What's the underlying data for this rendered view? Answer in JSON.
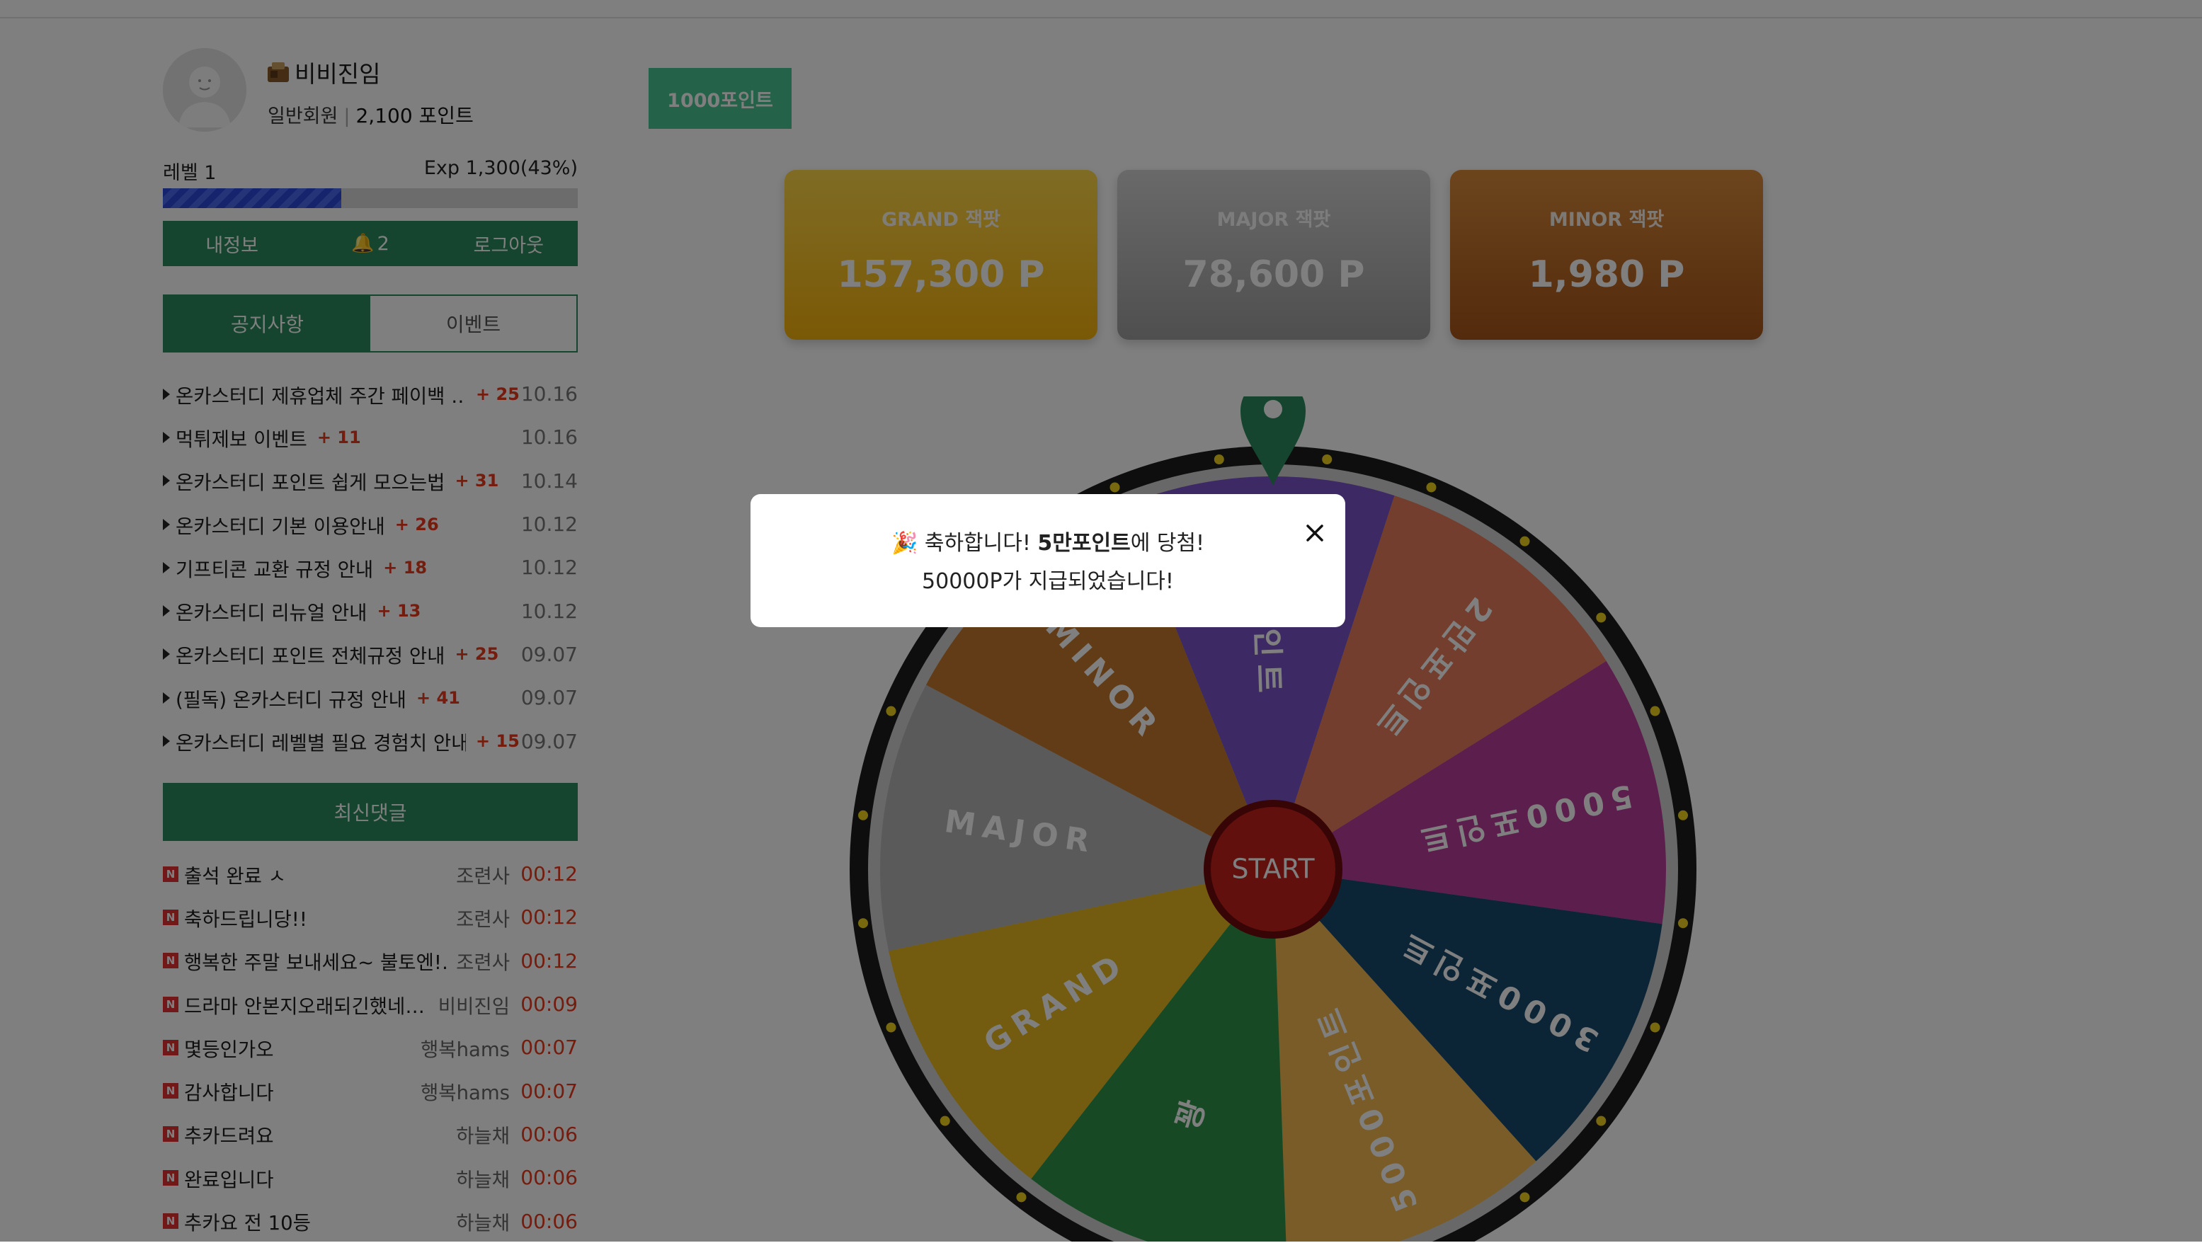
{
  "user": {
    "name": "비비진임",
    "grade": "일반회원",
    "points": "2,100 포인트",
    "level": "레벨 1",
    "exp": "Exp 1,300(43%)",
    "exp_progress": 0.43
  },
  "user_buttons": {
    "myinfo": "내정보",
    "notifications": "2",
    "logout": "로그아웃"
  },
  "tabs": {
    "notice": "공지사항",
    "event": "이벤트"
  },
  "notices": [
    {
      "title": "온카스터디 제휴업체 주간 페이백 …",
      "count": "+ 25",
      "date": "10.16"
    },
    {
      "title": "먹튀제보 이벤트",
      "count": "+ 11",
      "date": "10.16"
    },
    {
      "title": "온카스터디 포인트 쉽게 모으는법",
      "count": "+ 31",
      "date": "10.14"
    },
    {
      "title": "온카스터디 기본 이용안내",
      "count": "+ 26",
      "date": "10.12"
    },
    {
      "title": "기프티콘 교환 규정 안내",
      "count": "+ 18",
      "date": "10.12"
    },
    {
      "title": "온카스터디 리뉴얼 안내",
      "count": "+ 13",
      "date": "10.12"
    },
    {
      "title": "온카스터디 포인트 전체규정 안내",
      "count": "+ 25",
      "date": "09.07"
    },
    {
      "title": "(필독) 온카스터디 규정 안내",
      "count": "+ 41",
      "date": "09.07"
    },
    {
      "title": "온카스터디 레벨별 필요 경험치 안내",
      "count": "+ 15",
      "date": "09.07"
    }
  ],
  "recent_comments_title": "최신댓글",
  "new_badge": "N",
  "comments": [
    {
      "text": "출석 완료 ㅅ",
      "writer": "조련사",
      "time": "00:12"
    },
    {
      "text": "축하드립니당!!",
      "writer": "조련사",
      "time": "00:12"
    },
    {
      "text": "행복한 주말 보내세요~ 불토엔!…",
      "writer": "조련사",
      "time": "00:12"
    },
    {
      "text": "드라마 안본지오래되긴했네…",
      "writer": "비비진임",
      "time": "00:09"
    },
    {
      "text": "몇등인가오",
      "writer": "행복hams",
      "time": "00:07"
    },
    {
      "text": "감사합니다",
      "writer": "행복hams",
      "time": "00:07"
    },
    {
      "text": "추카드려요",
      "writer": "하늘채",
      "time": "00:06"
    },
    {
      "text": "완료입니다",
      "writer": "하늘채",
      "time": "00:06"
    },
    {
      "text": "추카요 전 10등",
      "writer": "하늘채",
      "time": "00:06"
    }
  ],
  "point_button": "1000포인트",
  "jackpots": [
    {
      "label": "GRAND 잭팟",
      "value": "157,300 P",
      "color": "#f5c21c"
    },
    {
      "label": "MAJOR 잭팟",
      "value": "78,600 P",
      "color": "#b8b8b8"
    },
    {
      "label": "MINOR 잭팟",
      "value": "1,980 P",
      "color": "#c06a26"
    }
  ],
  "wheel": {
    "start_label": "START",
    "pointer_color": "#2b8a5e",
    "segments": [
      {
        "label": "5만포인트",
        "color": "#7a52c8"
      },
      {
        "label": "2만포인트",
        "color": "#e67c5a"
      },
      {
        "label": "5000포인트",
        "color": "#b83e9a"
      },
      {
        "label": "3000포인트",
        "color": "#164a6e"
      },
      {
        "label": "5000포인트",
        "color": "#f2b84e"
      },
      {
        "label": "꽝",
        "color": "#2f9548"
      },
      {
        "label": "GRAND",
        "color": "#e6b81f"
      },
      {
        "label": "MAJOR",
        "color": "#b5b5b5"
      },
      {
        "label": "MINOR",
        "color": "#c4782c"
      }
    ]
  },
  "modal": {
    "emoji": "🎉",
    "congrats": "축하합니다! ",
    "prize": "5만포인트",
    "suffix": "에 당첨!",
    "line2": "50000P가 지급되었습니다!"
  }
}
